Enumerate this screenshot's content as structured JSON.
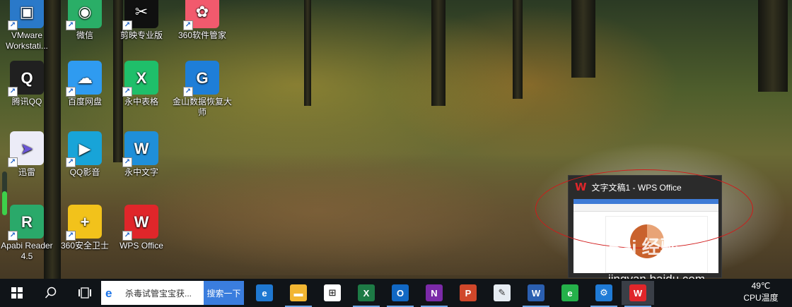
{
  "desktop": {
    "icons": [
      {
        "label": "VMware Workstati...",
        "icon": "vmware-icon",
        "color": "#2a79c9"
      },
      {
        "label": "微信",
        "icon": "wechat-icon",
        "color": "#2aae67"
      },
      {
        "label": "剪映专业版",
        "icon": "jianying-icon",
        "color": "#101010"
      },
      {
        "label": "360软件管家",
        "icon": "360-software-manager-icon",
        "color": "#f25a6d"
      },
      {
        "label": "腾讯QQ",
        "icon": "qq-icon",
        "color": "#202020"
      },
      {
        "label": "百度网盘",
        "icon": "baidu-netdisk-icon",
        "color": "#2f9bf0"
      },
      {
        "label": "永中表格",
        "icon": "yozo-sheet-icon",
        "color": "#1fbf6a"
      },
      {
        "label": "金山数据恢复大师",
        "icon": "kingsoft-data-recovery-icon",
        "color": "#1e7ed8"
      },
      {
        "label": "迅雷",
        "icon": "xunlei-icon",
        "color": "#ececf7"
      },
      {
        "label": "QQ影音",
        "icon": "qq-player-icon",
        "color": "#18a4d8"
      },
      {
        "label": "永中文字",
        "icon": "yozo-writer-icon",
        "color": "#1f8fd9"
      },
      {
        "label": "Apabi Reader 4.5",
        "icon": "apabi-reader-icon",
        "color": "#2aa96a"
      },
      {
        "label": "360安全卫士",
        "icon": "360-security-icon",
        "color": "#f2c21b"
      },
      {
        "label": "WPS Office",
        "icon": "wps-office-icon",
        "color": "#e0262a"
      }
    ],
    "volume_level": 0.55
  },
  "preview": {
    "title": "文字文稿1 - WPS Office",
    "logo_color": "#e0262a"
  },
  "watermark": {
    "text": "Bai 经验",
    "url": "jingyan.baidu.com"
  },
  "taskbar": {
    "start_icon": "windows-start-icon",
    "search_icon": "search-icon",
    "taskview_icon": "task-view-icon",
    "ie_search_value": "杀毒试管宝宝获...",
    "search_button": "搜索一下",
    "apps": [
      {
        "name": "edge",
        "icon": "edge-icon",
        "color": "#1f78d1",
        "glyph": "e"
      },
      {
        "name": "file-explorer",
        "icon": "folder-icon",
        "color": "#f2b632",
        "glyph": "▬"
      },
      {
        "name": "store",
        "icon": "store-icon",
        "color": "#ffffff",
        "glyph": "⊞"
      },
      {
        "name": "excel",
        "icon": "excel-icon",
        "color": "#1d7a45",
        "glyph": "X"
      },
      {
        "name": "outlook",
        "icon": "outlook-icon",
        "color": "#1168c4",
        "glyph": "O"
      },
      {
        "name": "onenote",
        "icon": "onenote-icon",
        "color": "#7b2aa8",
        "glyph": "N"
      },
      {
        "name": "powerpoint",
        "icon": "powerpoint-icon",
        "color": "#d0472a",
        "glyph": "P"
      },
      {
        "name": "paint",
        "icon": "paint-icon",
        "color": "#e6ecf2",
        "glyph": "✎"
      },
      {
        "name": "word",
        "icon": "word-icon",
        "color": "#2b5fb0",
        "glyph": "W"
      },
      {
        "name": "360-browser",
        "icon": "360-browser-icon",
        "color": "#25b14a",
        "glyph": "e"
      },
      {
        "name": "settings",
        "icon": "settings-icon",
        "color": "#1f7bd6",
        "glyph": "⚙"
      },
      {
        "name": "wps-office",
        "icon": "wps-office-icon",
        "color": "#e0262a",
        "glyph": "W"
      }
    ],
    "tray": {
      "temperature": "49℃",
      "temperature_label": "CPU温度"
    }
  }
}
